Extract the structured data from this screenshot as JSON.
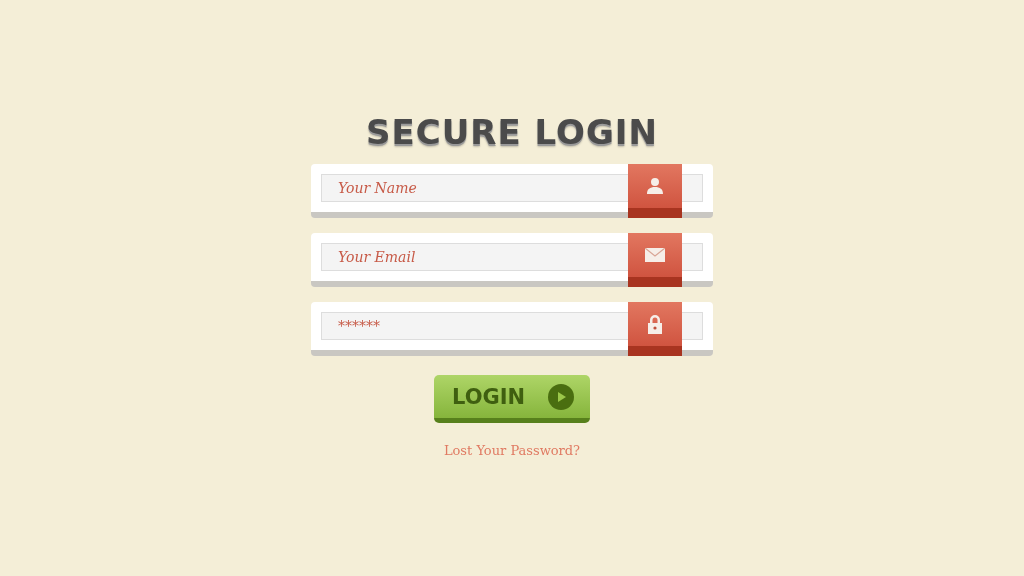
{
  "title": "SECURE LOGIN",
  "fields": [
    {
      "kind": "name",
      "placeholder": "Your Name"
    },
    {
      "kind": "email",
      "placeholder": "Your Email"
    },
    {
      "kind": "password",
      "placeholder": "******"
    }
  ],
  "login_button": {
    "label": "LOGIN"
  },
  "lost_password_link": "Lost Your Password?"
}
